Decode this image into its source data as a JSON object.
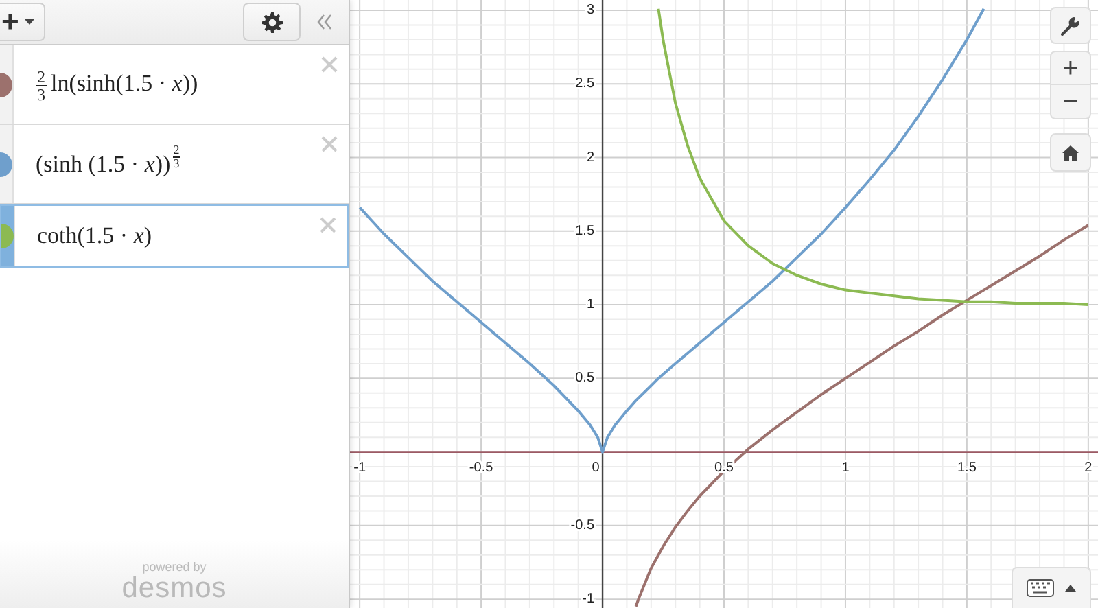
{
  "expression_panel": {
    "add_button": {
      "label": "+"
    },
    "expressions": [
      {
        "kind": "fraction_prefix",
        "fraction": {
          "numerator": "2",
          "denominator": "3"
        },
        "text": "ln(sinh(1.5 · *x*))",
        "color": "#9c716d",
        "selected": false
      },
      {
        "kind": "power",
        "text": "(sinh  (1.5 · *x*))",
        "exponent": {
          "numerator": "2",
          "denominator": "3"
        },
        "color": "#6f9fcc",
        "selected": false
      },
      {
        "kind": "plain",
        "text": "coth(1.5  · *x*)",
        "color": "#8cba52",
        "selected": true
      }
    ],
    "footer": {
      "line_1": "powered by",
      "line_2": "desmos"
    }
  },
  "graph": {
    "chart_data": {
      "type": "line",
      "grid": true,
      "xlim": [
        -1.04,
        2.04
      ],
      "ylim": [
        -1.06,
        3.07
      ],
      "xticks": [
        -1,
        -0.5,
        0,
        0.5,
        1,
        1.5,
        2
      ],
      "yticks": [
        -1,
        -0.5,
        0.5,
        1,
        1.5,
        2,
        2.5,
        3
      ],
      "x": [
        -1,
        -0.9,
        -0.8,
        -0.7,
        -0.6,
        -0.5,
        -0.4,
        -0.3,
        -0.2,
        -0.1,
        -0.05,
        -0.02,
        0,
        0.02,
        0.05,
        0.1,
        0.137,
        0.15,
        0.2,
        0.23,
        0.25,
        0.3,
        0.35,
        0.4,
        0.5,
        0.6,
        0.7,
        0.8,
        0.9,
        1,
        1.1,
        1.2,
        1.3,
        1.4,
        1.5,
        1.57,
        1.6,
        1.7,
        1.8,
        1.9,
        2
      ],
      "series": [
        {
          "color": "#9c716d",
          "values": [
            null,
            null,
            null,
            null,
            null,
            null,
            null,
            null,
            null,
            null,
            null,
            null,
            null,
            null,
            null,
            null,
            -1.05,
            -0.99,
            -0.79,
            -0.7,
            -0.64,
            -0.51,
            -0.4,
            -0.3,
            -0.13,
            0.02,
            0.15,
            0.27,
            0.39,
            0.5,
            0.61,
            0.72,
            0.82,
            0.93,
            1.03,
            1.1,
            1.13,
            1.23,
            1.33,
            1.44,
            1.54
          ]
        },
        {
          "color": "#6f9fcc",
          "values": [
            1.66,
            1.48,
            1.32,
            1.16,
            1.02,
            0.88,
            0.74,
            0.6,
            0.45,
            0.28,
            0.18,
            0.1,
            0,
            0.1,
            0.18,
            0.28,
            0.35,
            0.37,
            0.45,
            0.5,
            0.53,
            0.6,
            0.67,
            0.74,
            0.88,
            1.02,
            1.16,
            1.32,
            1.48,
            1.66,
            1.85,
            2.05,
            2.28,
            2.53,
            2.8,
            3.01,
            null,
            null,
            null,
            null,
            null
          ]
        },
        {
          "color": "#8cba52",
          "values": [
            null,
            null,
            null,
            null,
            null,
            null,
            null,
            null,
            null,
            null,
            null,
            null,
            null,
            null,
            null,
            null,
            null,
            null,
            null,
            3.01,
            2.79,
            2.37,
            2.08,
            1.86,
            1.57,
            1.4,
            1.28,
            1.2,
            1.14,
            1.1,
            1.08,
            1.06,
            1.04,
            1.03,
            1.02,
            1.02,
            1.02,
            1.01,
            1.01,
            1.01,
            1.0
          ]
        }
      ]
    }
  },
  "zoom_controls": {
    "zoom_in": "+",
    "zoom_out": "−"
  }
}
